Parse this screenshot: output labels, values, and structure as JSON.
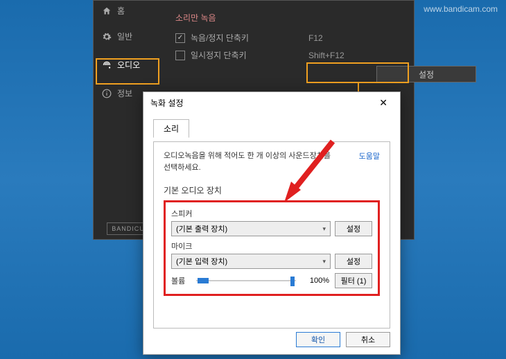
{
  "watermark": "www.bandicam.com",
  "logo": "BANDICU",
  "sidebar": {
    "home": "홈",
    "general": "일반",
    "audio": "오디오",
    "info": "정보"
  },
  "main": {
    "section_title": "소리만 녹음",
    "hotkey_record_label": "녹음/정지 단축키",
    "hotkey_record_value": "F12",
    "hotkey_pause_label": "일시정지 단축키",
    "hotkey_pause_value": "Shift+F12",
    "settings_btn": "설정"
  },
  "dialog": {
    "title": "녹화 설정",
    "tab_sound": "소리",
    "desc": "오디오녹음을 위해 적어도 한 개 이상의 사운드장치를 선택하세요.",
    "help": "도움말",
    "group_title": "기본 오디오 장치",
    "speaker_label": "스피커",
    "speaker_value": "(기본 출력 장치)",
    "speaker_btn": "설정",
    "mic_label": "마이크",
    "mic_value": "(기본 입력 장치)",
    "mic_btn": "설정",
    "volume_label": "볼륨",
    "volume_value": "100%",
    "filter_btn": "필터 (1)",
    "ok_btn": "확인",
    "cancel_btn": "취소"
  }
}
